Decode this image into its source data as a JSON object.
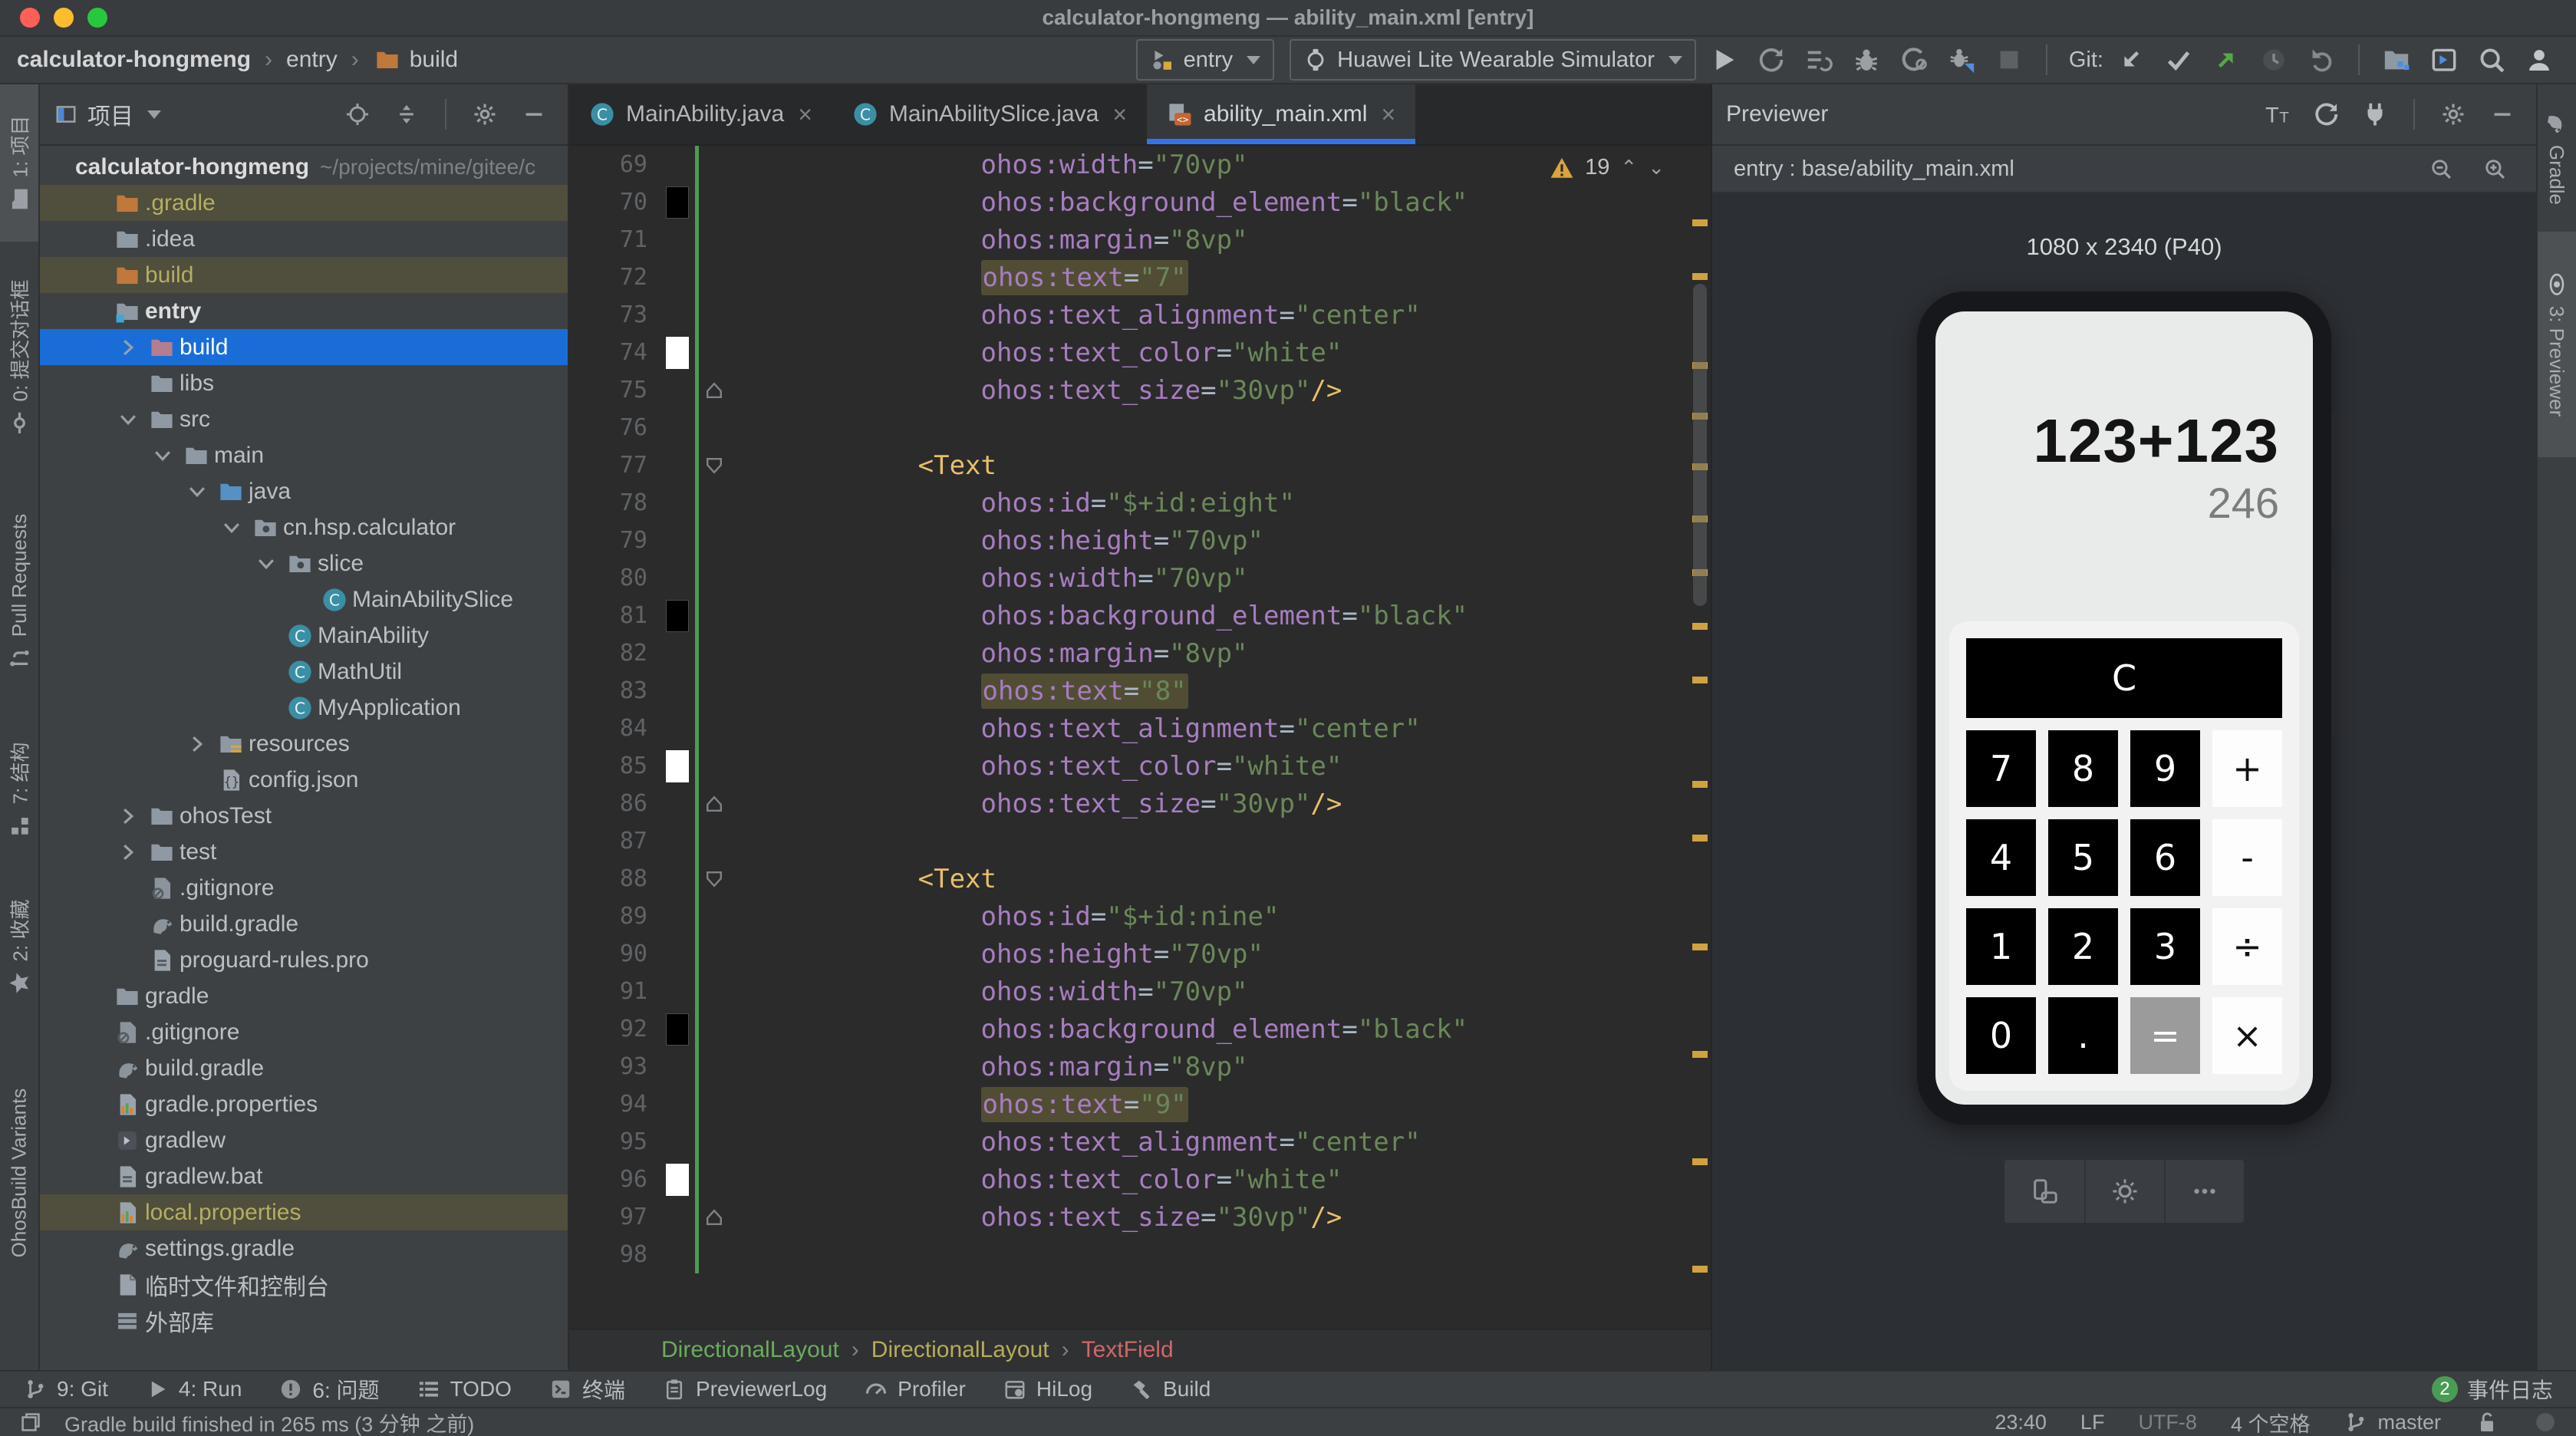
{
  "window": {
    "title": "calculator-hongmeng — ability_main.xml [entry]"
  },
  "toolbar": {
    "breadcrumbs": [
      "calculator-hongmeng",
      "entry",
      "build"
    ],
    "run_config": "entry",
    "device": "Huawei Lite Wearable Simulator",
    "git_label": "Git:",
    "icons": [
      "run-config",
      "watch",
      "play",
      "restart",
      "run-list",
      "debug",
      "profile",
      "attach-debugger",
      "stop",
      "git-update",
      "git-commit",
      "git-push",
      "git-history",
      "git-rollback",
      "project-structure",
      "terminal-window",
      "search",
      "profile-avatar"
    ]
  },
  "left_strip": [
    {
      "label": "1: 项目",
      "icon": "folder-tab",
      "active": true
    },
    {
      "label": "0: 提交对话框",
      "icon": "commit"
    },
    {
      "label": "Pull Requests",
      "icon": "pull-request"
    },
    {
      "label": "7: 结构",
      "icon": "structure"
    },
    {
      "label": "2: 收藏",
      "icon": "star"
    },
    {
      "label": "OhosBuild Variants",
      "icon": "none"
    }
  ],
  "right_strip": [
    {
      "label": "Gradle",
      "icon": "gradle"
    },
    {
      "label": "3: Previewer",
      "icon": "eye",
      "active": true
    }
  ],
  "project": {
    "header": "项目",
    "tree": [
      {
        "label": "calculator-hongmeng",
        "path": "~/projects/mine/gitee/c",
        "icon": "none",
        "level": 0,
        "bold": true
      },
      {
        "label": ".gradle",
        "icon": "folder-orange",
        "level": 1,
        "olive": true
      },
      {
        "label": ".idea",
        "icon": "folder",
        "level": 1
      },
      {
        "label": "build",
        "icon": "folder-orange",
        "level": 1,
        "olive": true
      },
      {
        "label": "entry",
        "icon": "folder-entry",
        "level": 1,
        "bold": true
      },
      {
        "label": "build",
        "icon": "folder-rose",
        "level": 2,
        "chevron": "right",
        "selected": true
      },
      {
        "label": "libs",
        "icon": "folder",
        "level": 2
      },
      {
        "label": "src",
        "icon": "folder",
        "level": 2,
        "chevron": "down"
      },
      {
        "label": "main",
        "icon": "folder",
        "level": 3,
        "chevron": "down"
      },
      {
        "label": "java",
        "icon": "folder-blue",
        "level": 4,
        "chevron": "down"
      },
      {
        "label": "cn.hsp.calculator",
        "icon": "package",
        "level": 5,
        "chevron": "down"
      },
      {
        "label": "slice",
        "icon": "package",
        "level": 6,
        "chevron": "down"
      },
      {
        "label": "MainAbilitySlice",
        "icon": "class",
        "level": 7
      },
      {
        "label": "MainAbility",
        "icon": "class",
        "level": 6
      },
      {
        "label": "MathUtil",
        "icon": "class",
        "level": 6
      },
      {
        "label": "MyApplication",
        "icon": "class",
        "level": 6
      },
      {
        "label": "resources",
        "icon": "folder-resources",
        "level": 4,
        "chevron": "right"
      },
      {
        "label": "config.json",
        "icon": "json",
        "level": 4
      },
      {
        "label": "ohosTest",
        "icon": "folder",
        "level": 2,
        "chevron": "right"
      },
      {
        "label": "test",
        "icon": "folder",
        "level": 2,
        "chevron": "right"
      },
      {
        "label": ".gitignore",
        "icon": "file-ignore",
        "level": 2
      },
      {
        "label": "build.gradle",
        "icon": "gradle-file",
        "level": 2
      },
      {
        "label": "proguard-rules.pro",
        "icon": "file-text",
        "level": 2
      },
      {
        "label": "gradle",
        "icon": "folder",
        "level": 1
      },
      {
        "label": ".gitignore",
        "icon": "file-ignore",
        "level": 1
      },
      {
        "label": "build.gradle",
        "icon": "gradle-file",
        "level": 1
      },
      {
        "label": "gradle.properties",
        "icon": "file-properties",
        "level": 1
      },
      {
        "label": "gradlew",
        "icon": "file-exec",
        "level": 1
      },
      {
        "label": "gradlew.bat",
        "icon": "file-text",
        "level": 1
      },
      {
        "label": "local.properties",
        "icon": "file-properties",
        "level": 1,
        "olive": true
      },
      {
        "label": "settings.gradle",
        "icon": "gradle-file",
        "level": 1
      },
      {
        "label": "临时文件和控制台",
        "icon": "scratch",
        "level": 1
      },
      {
        "label": "外部库",
        "icon": "libraries",
        "level": 1
      }
    ]
  },
  "editor": {
    "tabs": [
      {
        "label": "MainAbility.java",
        "icon": "class"
      },
      {
        "label": "MainAbilitySlice.java",
        "icon": "class"
      },
      {
        "label": "ability_main.xml",
        "icon": "xml",
        "active": true
      }
    ],
    "warning_count": "19",
    "lines": [
      {
        "n": 69,
        "i": 16,
        "s": [
          [
            "a",
            "ohos:width"
          ],
          [
            "e",
            "="
          ],
          [
            "s",
            "\"70vp\""
          ]
        ]
      },
      {
        "n": 70,
        "i": 16,
        "chip": "black",
        "s": [
          [
            "a",
            "ohos:background_element"
          ],
          [
            "e",
            "="
          ],
          [
            "s",
            "\"black\""
          ]
        ]
      },
      {
        "n": 71,
        "i": 16,
        "s": [
          [
            "a",
            "ohos:margin"
          ],
          [
            "e",
            "="
          ],
          [
            "s",
            "\"8vp\""
          ]
        ]
      },
      {
        "n": 72,
        "i": 16,
        "hl": true,
        "s": [
          [
            "a",
            "ohos:text"
          ],
          [
            "e",
            "="
          ],
          [
            "s",
            "\"7\""
          ]
        ]
      },
      {
        "n": 73,
        "i": 16,
        "s": [
          [
            "a",
            "ohos:text_alignment"
          ],
          [
            "e",
            "="
          ],
          [
            "s",
            "\"center\""
          ]
        ]
      },
      {
        "n": 74,
        "i": 16,
        "chip": "white",
        "s": [
          [
            "a",
            "ohos:text_color"
          ],
          [
            "e",
            "="
          ],
          [
            "s",
            "\"white\""
          ]
        ]
      },
      {
        "n": 75,
        "i": 16,
        "fold": "end",
        "s": [
          [
            "a",
            "ohos:text_size"
          ],
          [
            "e",
            "="
          ],
          [
            "s",
            "\"30vp\""
          ],
          [
            "t",
            "/>"
          ]
        ]
      },
      {
        "n": 76,
        "s": []
      },
      {
        "n": 77,
        "i": 12,
        "fold": "start",
        "s": [
          [
            "t",
            "<Text"
          ]
        ]
      },
      {
        "n": 78,
        "i": 16,
        "s": [
          [
            "a",
            "ohos:id"
          ],
          [
            "e",
            "="
          ],
          [
            "s",
            "\"$+id:eight\""
          ]
        ]
      },
      {
        "n": 79,
        "i": 16,
        "s": [
          [
            "a",
            "ohos:height"
          ],
          [
            "e",
            "="
          ],
          [
            "s",
            "\"70vp\""
          ]
        ]
      },
      {
        "n": 80,
        "i": 16,
        "s": [
          [
            "a",
            "ohos:width"
          ],
          [
            "e",
            "="
          ],
          [
            "s",
            "\"70vp\""
          ]
        ]
      },
      {
        "n": 81,
        "i": 16,
        "chip": "black",
        "s": [
          [
            "a",
            "ohos:background_element"
          ],
          [
            "e",
            "="
          ],
          [
            "s",
            "\"black\""
          ]
        ]
      },
      {
        "n": 82,
        "i": 16,
        "s": [
          [
            "a",
            "ohos:margin"
          ],
          [
            "e",
            "="
          ],
          [
            "s",
            "\"8vp\""
          ]
        ]
      },
      {
        "n": 83,
        "i": 16,
        "hl": true,
        "s": [
          [
            "a",
            "ohos:text"
          ],
          [
            "e",
            "="
          ],
          [
            "s",
            "\"8\""
          ]
        ]
      },
      {
        "n": 84,
        "i": 16,
        "s": [
          [
            "a",
            "ohos:text_alignment"
          ],
          [
            "e",
            "="
          ],
          [
            "s",
            "\"center\""
          ]
        ]
      },
      {
        "n": 85,
        "i": 16,
        "chip": "white",
        "s": [
          [
            "a",
            "ohos:text_color"
          ],
          [
            "e",
            "="
          ],
          [
            "s",
            "\"white\""
          ]
        ]
      },
      {
        "n": 86,
        "i": 16,
        "fold": "end",
        "s": [
          [
            "a",
            "ohos:text_size"
          ],
          [
            "e",
            "="
          ],
          [
            "s",
            "\"30vp\""
          ],
          [
            "t",
            "/>"
          ]
        ]
      },
      {
        "n": 87,
        "s": []
      },
      {
        "n": 88,
        "i": 12,
        "fold": "start",
        "s": [
          [
            "t",
            "<Text"
          ]
        ]
      },
      {
        "n": 89,
        "i": 16,
        "s": [
          [
            "a",
            "ohos:id"
          ],
          [
            "e",
            "="
          ],
          [
            "s",
            "\"$+id:nine\""
          ]
        ]
      },
      {
        "n": 90,
        "i": 16,
        "s": [
          [
            "a",
            "ohos:height"
          ],
          [
            "e",
            "="
          ],
          [
            "s",
            "\"70vp\""
          ]
        ]
      },
      {
        "n": 91,
        "i": 16,
        "s": [
          [
            "a",
            "ohos:width"
          ],
          [
            "e",
            "="
          ],
          [
            "s",
            "\"70vp\""
          ]
        ]
      },
      {
        "n": 92,
        "i": 16,
        "chip": "black",
        "s": [
          [
            "a",
            "ohos:background_element"
          ],
          [
            "e",
            "="
          ],
          [
            "s",
            "\"black\""
          ]
        ]
      },
      {
        "n": 93,
        "i": 16,
        "s": [
          [
            "a",
            "ohos:margin"
          ],
          [
            "e",
            "="
          ],
          [
            "s",
            "\"8vp\""
          ]
        ]
      },
      {
        "n": 94,
        "i": 16,
        "hl": true,
        "s": [
          [
            "a",
            "ohos:text"
          ],
          [
            "e",
            "="
          ],
          [
            "s",
            "\"9\""
          ]
        ]
      },
      {
        "n": 95,
        "i": 16,
        "s": [
          [
            "a",
            "ohos:text_alignment"
          ],
          [
            "e",
            "="
          ],
          [
            "s",
            "\"center\""
          ]
        ]
      },
      {
        "n": 96,
        "i": 16,
        "chip": "white",
        "s": [
          [
            "a",
            "ohos:text_color"
          ],
          [
            "e",
            "="
          ],
          [
            "s",
            "\"white\""
          ]
        ]
      },
      {
        "n": 97,
        "i": 16,
        "fold": "end",
        "s": [
          [
            "a",
            "ohos:text_size"
          ],
          [
            "e",
            "="
          ],
          [
            "s",
            "\"30vp\""
          ],
          [
            "t",
            "/>"
          ]
        ]
      },
      {
        "n": 98,
        "s": []
      }
    ],
    "breadcrumbs": [
      {
        "label": "DirectionalLayout",
        "color": "#6cab5d"
      },
      {
        "label": "DirectionalLayout",
        "color": "#b8ab58"
      },
      {
        "label": "TextField",
        "color": "#cf6767"
      }
    ]
  },
  "previewer": {
    "title": "Previewer",
    "file_label": "entry : base/ability_main.xml",
    "resolution": "1080 x 2340 (P40)",
    "display": {
      "expression": "123+123",
      "result": "246"
    },
    "keypad": {
      "clear": "C",
      "rows": [
        [
          {
            "l": "7",
            "t": "num"
          },
          {
            "l": "8",
            "t": "num"
          },
          {
            "l": "9",
            "t": "num"
          },
          {
            "l": "+",
            "t": "op"
          }
        ],
        [
          {
            "l": "4",
            "t": "num"
          },
          {
            "l": "5",
            "t": "num"
          },
          {
            "l": "6",
            "t": "num"
          },
          {
            "l": "-",
            "t": "op"
          }
        ],
        [
          {
            "l": "1",
            "t": "num"
          },
          {
            "l": "2",
            "t": "num"
          },
          {
            "l": "3",
            "t": "num"
          },
          {
            "l": "÷",
            "t": "op"
          }
        ],
        [
          {
            "l": "0",
            "t": "num"
          },
          {
            "l": ".",
            "t": "num"
          },
          {
            "l": "=",
            "t": "eq"
          },
          {
            "l": "×",
            "t": "op"
          }
        ]
      ]
    },
    "device_bar_icons": [
      "rotate-device",
      "brightness",
      "more"
    ]
  },
  "bottom_bar": {
    "items": [
      {
        "label": "9: Git",
        "icon": "git-branch"
      },
      {
        "label": "4: Run",
        "icon": "play-small"
      },
      {
        "label": "6: 问题",
        "icon": "problems"
      },
      {
        "label": "TODO",
        "icon": "todo-list"
      },
      {
        "label": "终端",
        "icon": "terminal"
      },
      {
        "label": "PreviewerLog",
        "icon": "clipboard"
      },
      {
        "label": "Profiler",
        "icon": "gauge"
      },
      {
        "label": "HiLog",
        "icon": "hilog"
      },
      {
        "label": "Build",
        "icon": "hammer"
      }
    ],
    "event_log": {
      "badge": "2",
      "label": "事件日志"
    }
  },
  "status_bar": {
    "message": "Gradle build finished in 265 ms (3 分钟 之前)",
    "segments": [
      "23:40",
      "LF",
      "UTF-8",
      "4 个空格"
    ],
    "branch": "master"
  }
}
